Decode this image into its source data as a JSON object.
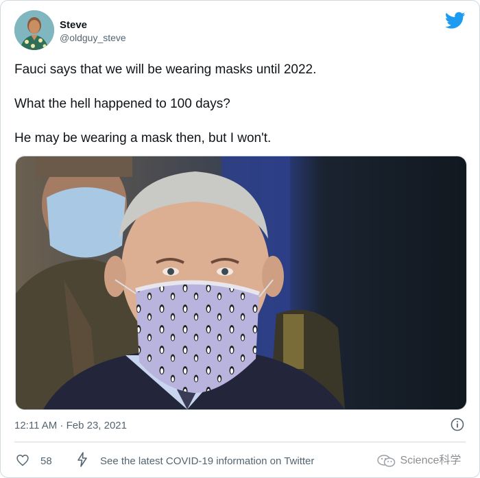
{
  "tweet": {
    "user": {
      "display_name": "Steve",
      "handle": "@oldguy_steve",
      "avatar_icon": "avatar-sims-character"
    },
    "logo_icon": "twitter-bird-icon",
    "lines": [
      "Fauci says that we will be wearing masks until 2022.",
      "What the hell happened to 100 days?",
      "He may be wearing a mask then, but I won't."
    ],
    "media_icon": "photo-fauci-penguin-mask",
    "timestamp": "12:11 AM · Feb 23, 2021",
    "info_icon": "info-icon",
    "actions": {
      "like_icon": "heart-icon",
      "like_count": "58",
      "covid_icon": "lightning-bolt-icon",
      "covid_link": "See the latest COVID-19 information on Twitter"
    }
  },
  "watermark": {
    "icon": "wechat-icon",
    "text": "Science科学"
  },
  "colors": {
    "twitter_blue": "#1d9bf0",
    "text_primary": "#0f1419",
    "text_secondary": "#536471",
    "border": "#cfd9de"
  }
}
